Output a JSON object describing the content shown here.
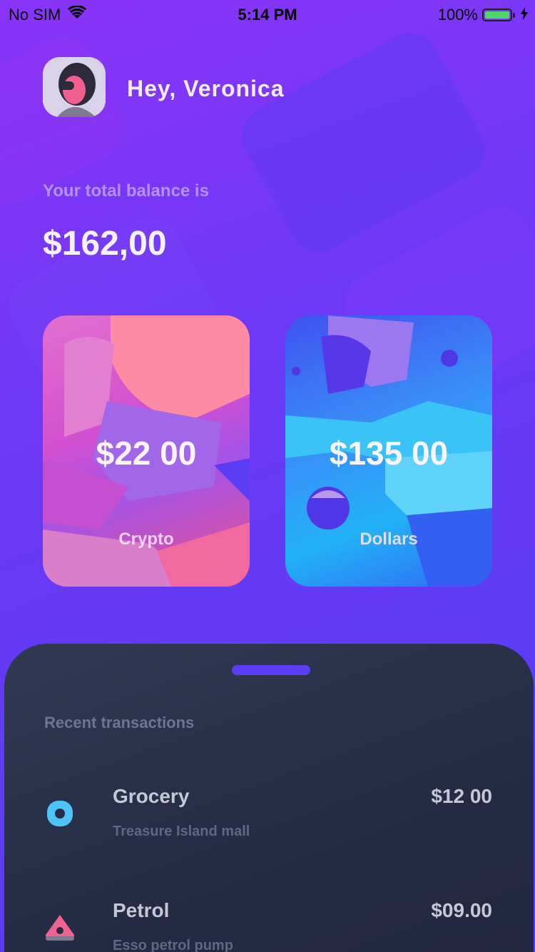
{
  "status_bar": {
    "carrier": "No SIM",
    "time": "5:14 PM",
    "battery": "100%",
    "battery_level": 1.0
  },
  "header": {
    "greeting": "Hey, Veronica"
  },
  "balance": {
    "label": "Your total balance is",
    "amount": "$162,00"
  },
  "cards": [
    {
      "amount": "$22 00",
      "label": "Crypto"
    },
    {
      "amount": "$135 00",
      "label": "Dollars"
    }
  ],
  "transactions": {
    "title": "Recent transactions",
    "items": [
      {
        "name": "Grocery",
        "subtitle": "Treasure Island mall",
        "amount": "$12 00",
        "icon": "grocery-icon",
        "icon_color": "#4fc3f7"
      },
      {
        "name": "Petrol",
        "subtitle": "Esso petrol pump",
        "amount": "$09.00",
        "icon": "petrol-icon",
        "icon_color": "#f06292"
      }
    ]
  },
  "colors": {
    "background": "#6f38f6",
    "sheet": "#262c45",
    "accent": "#5a3cf5"
  }
}
